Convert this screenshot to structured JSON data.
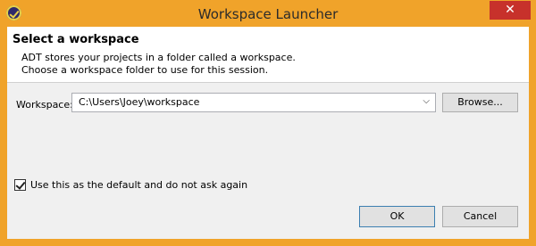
{
  "window": {
    "title": "Workspace Launcher",
    "close_symbol": "✕"
  },
  "header": {
    "title": "Select a workspace",
    "description_line1": "ADT stores your projects in a folder called a workspace.",
    "description_line2": "Choose a workspace folder to use for this session."
  },
  "form": {
    "workspace_label": "Workspace:",
    "workspace_value": "C:\\Users\\Joey\\workspace",
    "browse_label": "Browse...",
    "default_checkbox_label": "Use this as the default and do not ask again",
    "default_checked": true
  },
  "buttons": {
    "ok_label": "OK",
    "cancel_label": "Cancel"
  },
  "colors": {
    "title_bar": "#f0a32a",
    "close_button": "#c7312b",
    "dialog_bg": "#f0f0f0"
  }
}
